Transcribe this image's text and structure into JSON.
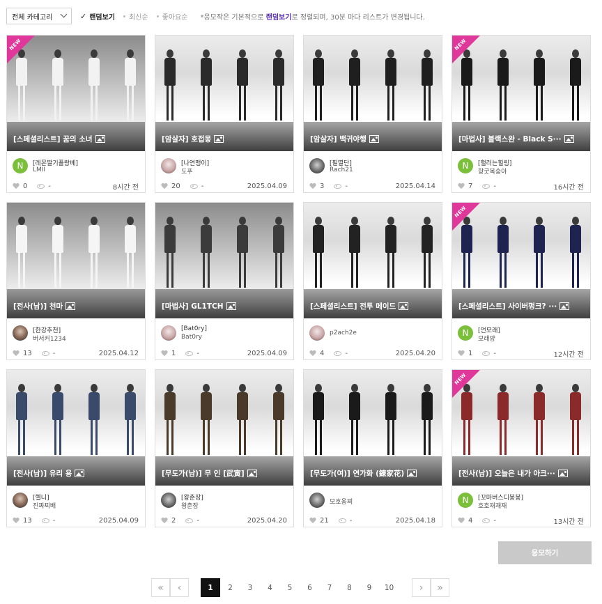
{
  "filters": {
    "category": "전체 카테고리",
    "sorts": [
      {
        "label": "랜덤보기",
        "active": true
      },
      {
        "label": "최신순",
        "active": false
      },
      {
        "label": "좋아요순",
        "active": false
      }
    ],
    "notice_before": "*응모작은 기본적으로 ",
    "notice_highlight": "랜덤보기",
    "notice_after": "로 정렬되며, 30분 마다 리스트가 변경됩니다."
  },
  "cards": [
    {
      "title": "[스페셜리스트] 꿈의 소녀",
      "new": true,
      "guild": "[레몬딸기플랑베]",
      "author": "LMII",
      "avatar": "N",
      "likes": "0",
      "views": "-",
      "date": "8시간 전",
      "theme": "dark",
      "outfit": "#f2f2f2"
    },
    {
      "title": "[암살자] 호접몽",
      "new": false,
      "guild": "[나연맹이]",
      "author": "도푸",
      "avatar": "photo2",
      "likes": "20",
      "views": "-",
      "date": "2025.04.09",
      "theme": "light",
      "outfit": "#2a2a2a"
    },
    {
      "title": "[암살자] 백귀야행",
      "new": false,
      "guild": "[필멸단]",
      "author": "Rach21",
      "avatar": "photo3",
      "likes": "3",
      "views": "-",
      "date": "2025.04.14",
      "theme": "light",
      "outfit": "#1f1f1f"
    },
    {
      "title": "[마법사] 블랙스완 - Black S···",
      "new": true,
      "guild": "[헐러는힐링]",
      "author": "항굿복숭아",
      "avatar": "N",
      "likes": "7",
      "views": "-",
      "date": "16시간 전",
      "theme": "light",
      "outfit": "#1a1a1a"
    },
    {
      "title": "[전사(남)] 천마",
      "new": false,
      "guild": "[한강추천]",
      "author": "버서커1234",
      "avatar": "photo",
      "likes": "13",
      "views": "-",
      "date": "2025.04.12",
      "theme": "dark",
      "outfit": "#f5f5f5"
    },
    {
      "title": "[마법사] GL1TCH",
      "new": false,
      "guild": "[Bat0ry]",
      "author": "Bat0ry",
      "avatar": "photo2",
      "likes": "1",
      "views": "-",
      "date": "2025.04.09",
      "theme": "dark",
      "outfit": "#3b3b3b"
    },
    {
      "title": "[스페셜리스트] 전투 메이드",
      "new": false,
      "guild": "",
      "author": "p2ach2e",
      "avatar": "photo2",
      "likes": "4",
      "views": "-",
      "date": "2025.04.20",
      "theme": "light",
      "outfit": "#222222"
    },
    {
      "title": "[스페셜리스트] 사이버펑크? ···",
      "new": true,
      "guild": "[언모래]",
      "author": "모래양",
      "avatar": "N",
      "likes": "1",
      "views": "-",
      "date": "12시간 전",
      "theme": "light",
      "outfit": "#1e2350"
    },
    {
      "title": "[전사(남)] 유리 용",
      "new": false,
      "guild": "[헬니]",
      "author": "진짜찌배",
      "avatar": "photo",
      "likes": "13",
      "views": "-",
      "date": "2025.04.09",
      "theme": "light",
      "outfit": "#3a4a6a"
    },
    {
      "title": "[무도가(남)] 무 인 [武寅]",
      "new": false,
      "guild": "[왕춘장]",
      "author": "왕춘장",
      "avatar": "photo3",
      "likes": "2",
      "views": "-",
      "date": "2025.04.20",
      "theme": "light",
      "outfit": "#4a3a2a"
    },
    {
      "title": "[무도가(여)] 연가화 (錬家花)",
      "new": false,
      "guild": "",
      "author": "모호옹찌",
      "avatar": "photo3",
      "likes": "21",
      "views": "-",
      "date": "2025.04.18",
      "theme": "light",
      "outfit": "#1a1a1a"
    },
    {
      "title": "[전사(남)] 오늘은 내가 아크···",
      "new": true,
      "guild": "[꼬마버스디붕붕]",
      "author": "호호재재재",
      "avatar": "N",
      "likes": "4",
      "views": "-",
      "date": "13시간 전",
      "theme": "light",
      "outfit": "#8a2a2a"
    }
  ],
  "submit_label": "응모하기",
  "pagination": {
    "pages": [
      "1",
      "2",
      "3",
      "4",
      "5",
      "6",
      "7",
      "8",
      "9",
      "10"
    ],
    "current": "1",
    "first_icon": "double-chevron-left-icon",
    "prev_icon": "chevron-left-icon",
    "next_icon": "chevron-right-icon",
    "last_icon": "double-chevron-right-icon"
  },
  "colors": {
    "accent": "#5a2db4",
    "new_badge": "#e0389a",
    "avatar_green": "#7cbf3a",
    "submit_disabled": "#c9c9c9",
    "page_active": "#111111"
  },
  "badge_text": "NEW"
}
